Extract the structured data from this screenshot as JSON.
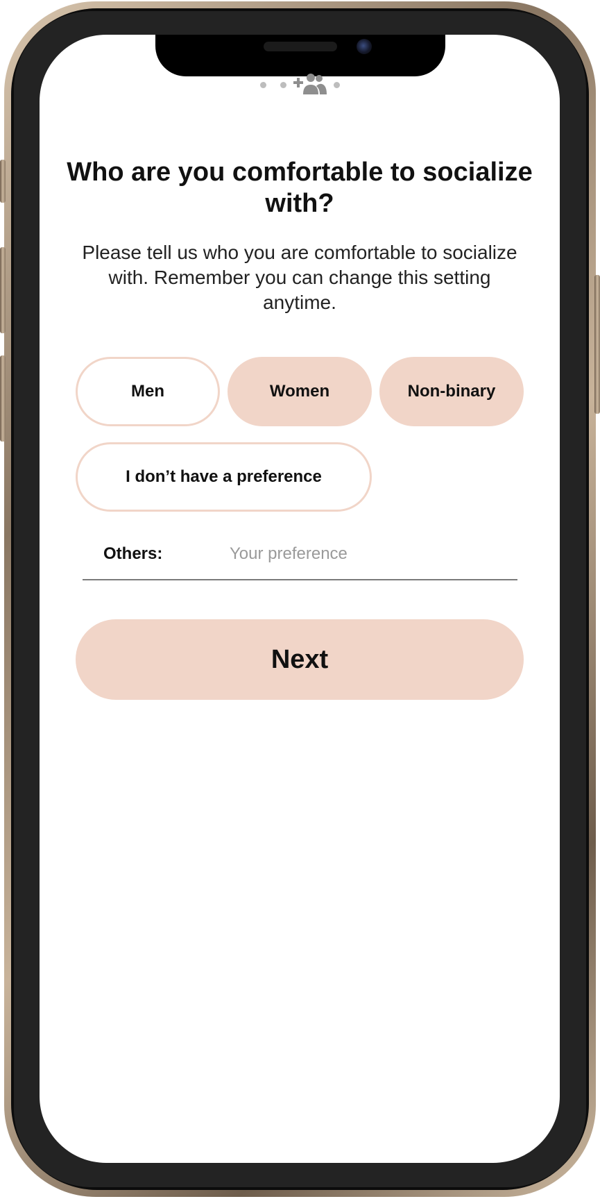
{
  "progress": {
    "total_steps": 4,
    "current_step": 3,
    "step_icon": "add-group-icon"
  },
  "screen": {
    "title": "Who are you comfortable to socialize with?",
    "subtitle": "Please tell us who you are comfortable to socialize with. Remember you can change this setting anytime."
  },
  "options": [
    {
      "label": "Men",
      "selected": false
    },
    {
      "label": "Women",
      "selected": true
    },
    {
      "label": "Non-binary",
      "selected": true
    },
    {
      "label": "I don’t have a preference",
      "selected": false
    }
  ],
  "others": {
    "label": "Others:",
    "placeholder": "Your preference",
    "value": ""
  },
  "next_button": {
    "label": "Next"
  },
  "colors": {
    "accent": "#f1d5c8",
    "text": "#111111",
    "placeholder": "#9a9a9a",
    "progress_dot": "#bdbdbd"
  }
}
